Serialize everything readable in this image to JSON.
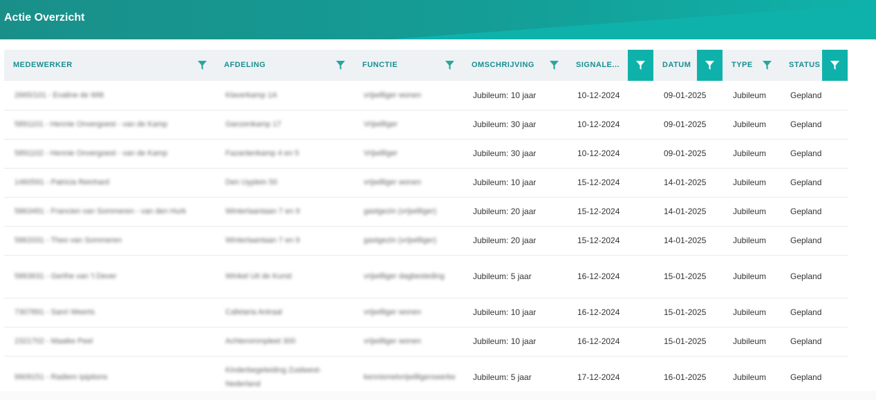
{
  "header": {
    "title": "Actie Overzicht"
  },
  "table": {
    "columns": [
      {
        "label": "MEDEWERKER",
        "filter_active": false
      },
      {
        "label": "AFDELING",
        "filter_active": false
      },
      {
        "label": "FUNCTIE",
        "filter_active": false
      },
      {
        "label": "OMSCHRIJVING",
        "filter_active": false
      },
      {
        "label": "SIGNALE...",
        "filter_active": true
      },
      {
        "label": "DATUM",
        "filter_active": true
      },
      {
        "label": "TYPE",
        "filter_active": false
      },
      {
        "label": "STATUS",
        "filter_active": true
      }
    ],
    "filter_icon": "filter-funnel-icon",
    "rows": [
      {
        "medewerker": "2665/101 - Evaline de Witt",
        "afdeling": "Klaverkamp 1A",
        "functie": "vrijwilliger wonen",
        "omschrijving": "Jubileum: 10 jaar",
        "signalering": "10-12-2024",
        "datum": "09-01-2025",
        "type": "Jubileum",
        "status": "Gepland"
      },
      {
        "medewerker": "5891101 - Hennie Onvergoest - van de Kamp",
        "afdeling": "Ganzenkamp 17",
        "functie": "Vrijwilliger",
        "omschrijving": "Jubileum: 30 jaar",
        "signalering": "10-12-2024",
        "datum": "09-01-2025",
        "type": "Jubileum",
        "status": "Gepland"
      },
      {
        "medewerker": "5891102 - Hennie Onvergoest - van de Kamp",
        "afdeling": "Fazantenkamp 4 en 5",
        "functie": "Vrijwilliger",
        "omschrijving": "Jubileum: 30 jaar",
        "signalering": "10-12-2024",
        "datum": "09-01-2025",
        "type": "Jubileum",
        "status": "Gepland"
      },
      {
        "medewerker": "1460591 - Patricia Reinhard",
        "afdeling": "Den Uyplein 50",
        "functie": "vrijwilliger wonen",
        "omschrijving": "Jubileum: 10 jaar",
        "signalering": "15-12-2024",
        "datum": "14-01-2025",
        "type": "Jubileum",
        "status": "Gepland"
      },
      {
        "medewerker": "5863491 - Francien van Sommeren - van den Hurk",
        "afdeling": "Winterlaantaan 7 en 9",
        "functie": "gastgezin (vrijwilliger)",
        "omschrijving": "Jubileum: 20 jaar",
        "signalering": "15-12-2024",
        "datum": "14-01-2025",
        "type": "Jubileum",
        "status": "Gepland"
      },
      {
        "medewerker": "5863331 - Theo van Sommeren",
        "afdeling": "Winterlaantaan 7 en 9",
        "functie": "gastgezin (vrijwilliger)",
        "omschrijving": "Jubileum: 20 jaar",
        "signalering": "15-12-2024",
        "datum": "14-01-2025",
        "type": "Jubileum",
        "status": "Gepland"
      },
      {
        "medewerker": "5863631 - Gerthe van 't Dever",
        "afdeling": "Winkel Uit de Kunst",
        "functie": "vrijwilliger dagbesteding",
        "omschrijving": "Jubileum: 5 jaar",
        "signalering": "16-12-2024",
        "datum": "15-01-2025",
        "type": "Jubileum",
        "status": "Gepland"
      },
      {
        "medewerker": "7307891 - Sanri Weerts",
        "afdeling": "Cafetaria Antraal",
        "functie": "vrijwilliger wonen",
        "omschrijving": "Jubileum: 10 jaar",
        "signalering": "16-12-2024",
        "datum": "15-01-2025",
        "type": "Jubileum",
        "status": "Gepland"
      },
      {
        "medewerker": "2321702 - Maaike Peel",
        "afdeling": "Achterommpleet 300",
        "functie": "vrijwilliger wonen",
        "omschrijving": "Jubileum: 10 jaar",
        "signalering": "16-12-2024",
        "datum": "15-01-2025",
        "type": "Jubileum",
        "status": "Gepland"
      },
      {
        "medewerker": "9909151 - Radiem Ipiptions",
        "afdeling": "Kinderbegeleiding Zuidwest-Nederland",
        "functie": "kennismetvrijwilligerswerke",
        "omschrijving": "Jubileum: 5 jaar",
        "signalering": "17-12-2024",
        "datum": "16-01-2025",
        "type": "Jubileum",
        "status": "Gepland"
      }
    ]
  },
  "colors": {
    "header_bg": "#149d96",
    "accent": "#0fb2aa",
    "header_text": "#1a8d8f",
    "table_header_bg": "#eef2f5"
  }
}
